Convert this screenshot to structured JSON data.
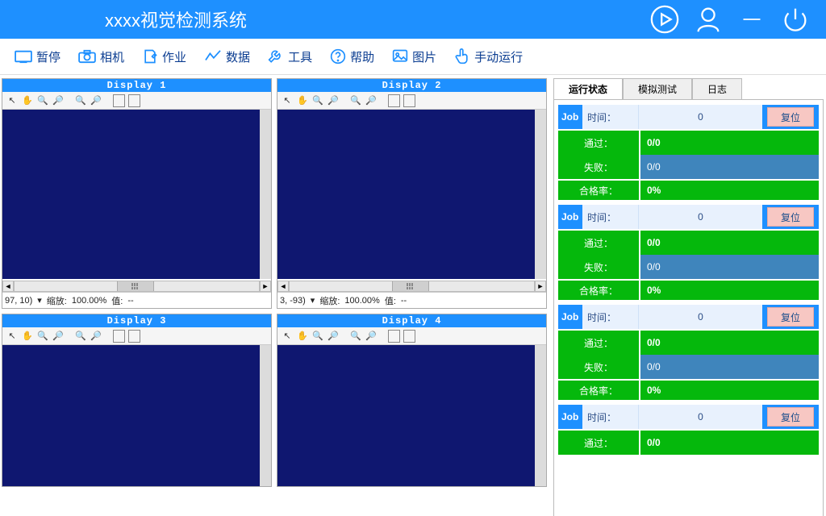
{
  "header": {
    "title": "xxxx视觉检测系统"
  },
  "toolbar": {
    "pause": "暂停",
    "camera": "相机",
    "job": "作业",
    "data": "数据",
    "tool": "工具",
    "help": "帮助",
    "image": "图片",
    "manual": "手动运行"
  },
  "displays": [
    {
      "title": "Display 1",
      "coord": "97, 10)",
      "zoom_lbl": "缩放:",
      "zoom": "100.00%",
      "val_lbl": "值:",
      "val": "--"
    },
    {
      "title": "Display 2",
      "coord": "3, -93)",
      "zoom_lbl": "缩放:",
      "zoom": "100.00%",
      "val_lbl": "值:",
      "val": "--"
    },
    {
      "title": "Display 3"
    },
    {
      "title": "Display 4"
    }
  ],
  "tabs": {
    "status": "运行状态",
    "sim": "模拟测试",
    "log": "日志"
  },
  "job": {
    "prefix": "Job",
    "time_lbl": "时间：",
    "time_val": "0",
    "reset": "复位",
    "pass_lbl": "通过：",
    "pass_val": "0/0",
    "fail_lbl": "失败：",
    "fail_val": "0/0",
    "rate_lbl": "合格率：",
    "rate_val": "0%"
  }
}
